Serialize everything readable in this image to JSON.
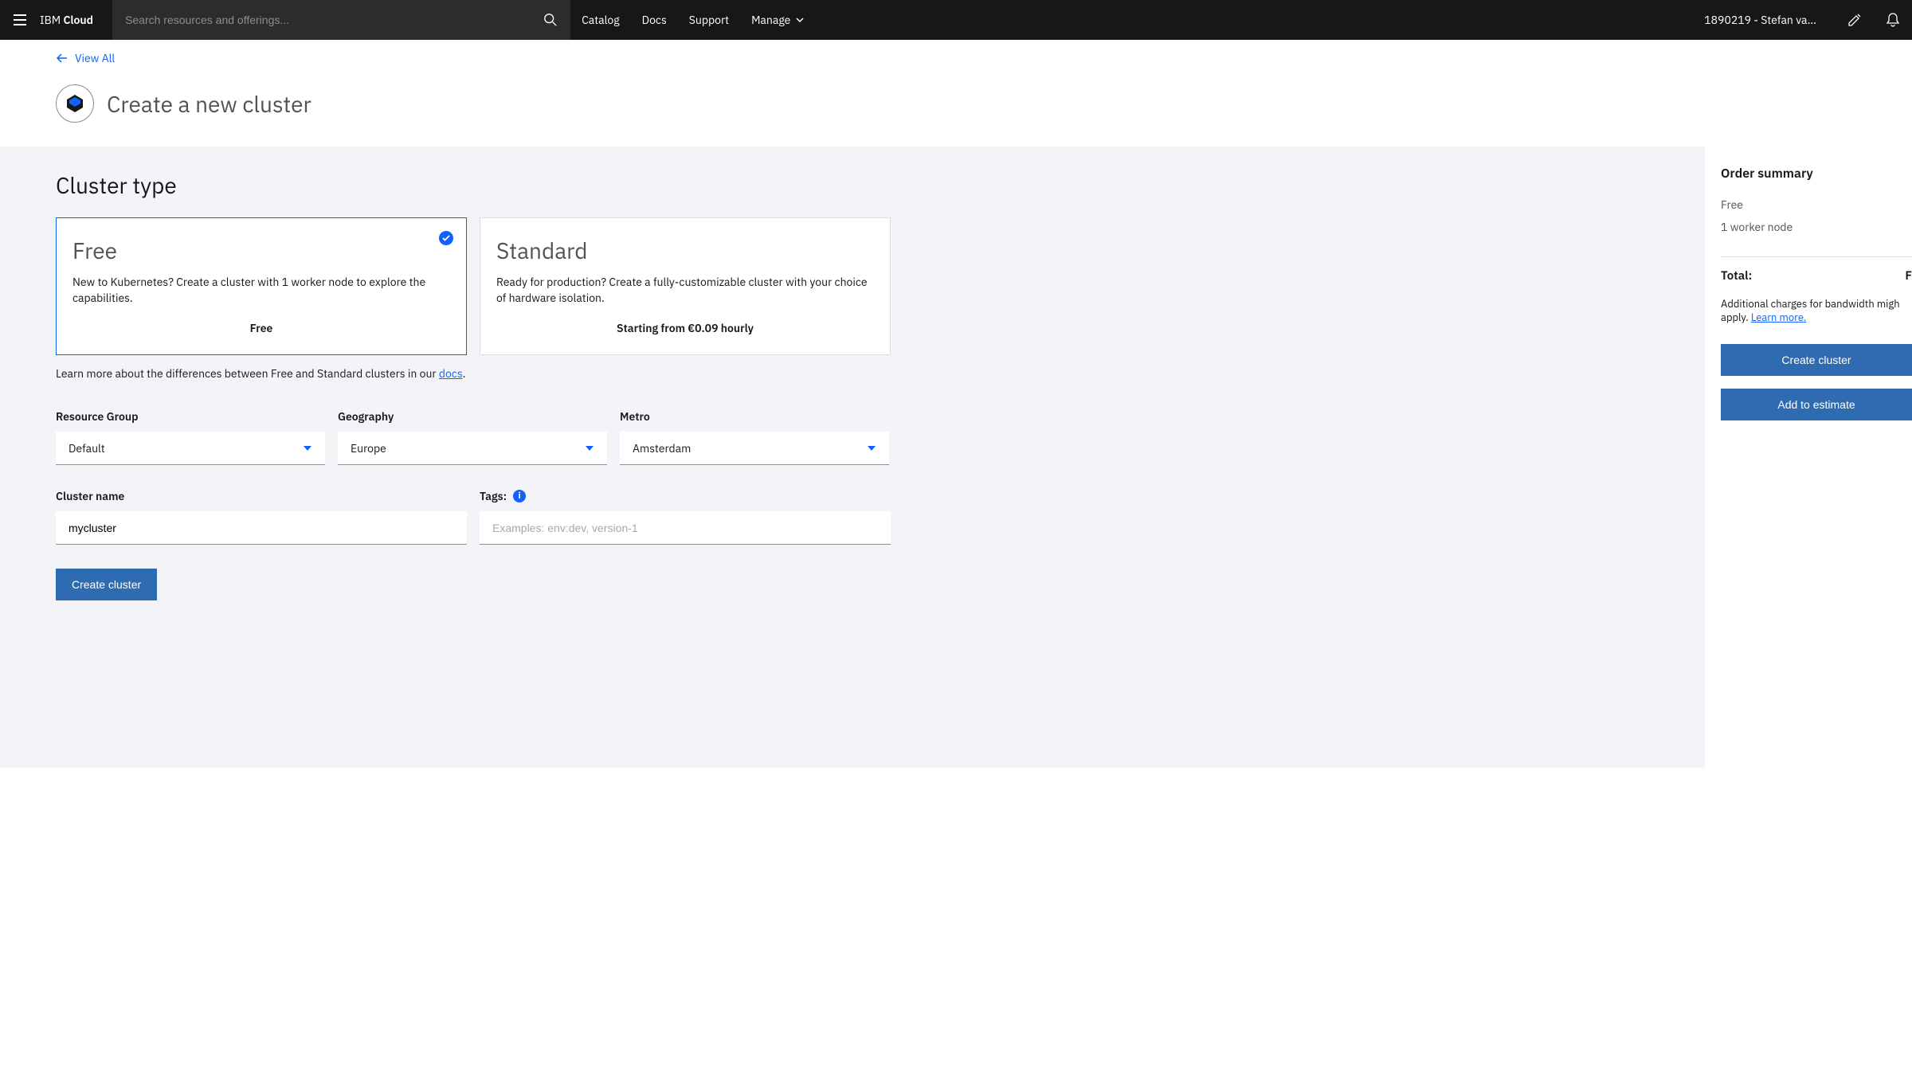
{
  "header": {
    "brand_prefix": "IBM",
    "brand_suffix": "Cloud",
    "search_placeholder": "Search resources and offerings...",
    "nav": {
      "catalog": "Catalog",
      "docs": "Docs",
      "support": "Support",
      "manage": "Manage"
    },
    "account": "1890219 - Stefan va..."
  },
  "back_link": "View All",
  "page_title": "Create a new cluster",
  "cluster_type": {
    "section_title": "Cluster type",
    "free": {
      "title": "Free",
      "desc": "New to Kubernetes? Create a cluster with 1 worker node to explore the capabilities.",
      "price": "Free"
    },
    "standard": {
      "title": "Standard",
      "desc": "Ready for production? Create a fully-customizable cluster with your choice of hardware isolation.",
      "price": "Starting from €0.09 hourly"
    },
    "helper_prefix": "Learn more about the differences between Free and Standard clusters in our ",
    "helper_link": "docs",
    "helper_suffix": "."
  },
  "fields": {
    "resource_group": {
      "label": "Resource Group",
      "value": "Default"
    },
    "geography": {
      "label": "Geography",
      "value": "Europe"
    },
    "metro": {
      "label": "Metro",
      "value": "Amsterdam"
    },
    "cluster_name": {
      "label": "Cluster name",
      "value": "mycluster"
    },
    "tags": {
      "label": "Tags:",
      "placeholder": "Examples: env:dev, version-1"
    }
  },
  "create_button": "Create cluster",
  "summary": {
    "title": "Order summary",
    "plan": "Free",
    "workers": "1 worker node",
    "total_label": "Total:",
    "total_value": "F",
    "note_prefix": "Additional charges for bandwidth migh",
    "note_suffix": "apply. ",
    "learn_more": "Learn more.",
    "create_btn": "Create cluster",
    "estimate_btn": "Add to estimate"
  }
}
